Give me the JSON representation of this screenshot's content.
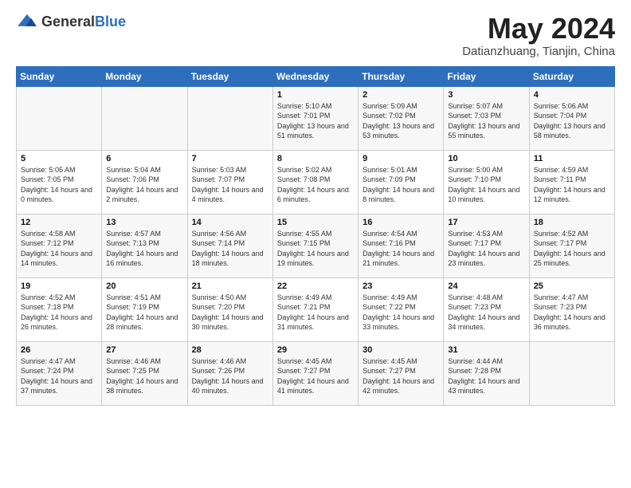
{
  "header": {
    "logo_general": "General",
    "logo_blue": "Blue",
    "month": "May 2024",
    "location": "Datianzhuang, Tianjin, China"
  },
  "weekdays": [
    "Sunday",
    "Monday",
    "Tuesday",
    "Wednesday",
    "Thursday",
    "Friday",
    "Saturday"
  ],
  "weeks": [
    [
      {
        "day": "",
        "sunrise": "",
        "sunset": "",
        "daylight": ""
      },
      {
        "day": "",
        "sunrise": "",
        "sunset": "",
        "daylight": ""
      },
      {
        "day": "",
        "sunrise": "",
        "sunset": "",
        "daylight": ""
      },
      {
        "day": "1",
        "sunrise": "Sunrise: 5:10 AM",
        "sunset": "Sunset: 7:01 PM",
        "daylight": "Daylight: 13 hours and 51 minutes."
      },
      {
        "day": "2",
        "sunrise": "Sunrise: 5:09 AM",
        "sunset": "Sunset: 7:02 PM",
        "daylight": "Daylight: 13 hours and 53 minutes."
      },
      {
        "day": "3",
        "sunrise": "Sunrise: 5:07 AM",
        "sunset": "Sunset: 7:03 PM",
        "daylight": "Daylight: 13 hours and 55 minutes."
      },
      {
        "day": "4",
        "sunrise": "Sunrise: 5:06 AM",
        "sunset": "Sunset: 7:04 PM",
        "daylight": "Daylight: 13 hours and 58 minutes."
      }
    ],
    [
      {
        "day": "5",
        "sunrise": "Sunrise: 5:05 AM",
        "sunset": "Sunset: 7:05 PM",
        "daylight": "Daylight: 14 hours and 0 minutes."
      },
      {
        "day": "6",
        "sunrise": "Sunrise: 5:04 AM",
        "sunset": "Sunset: 7:06 PM",
        "daylight": "Daylight: 14 hours and 2 minutes."
      },
      {
        "day": "7",
        "sunrise": "Sunrise: 5:03 AM",
        "sunset": "Sunset: 7:07 PM",
        "daylight": "Daylight: 14 hours and 4 minutes."
      },
      {
        "day": "8",
        "sunrise": "Sunrise: 5:02 AM",
        "sunset": "Sunset: 7:08 PM",
        "daylight": "Daylight: 14 hours and 6 minutes."
      },
      {
        "day": "9",
        "sunrise": "Sunrise: 5:01 AM",
        "sunset": "Sunset: 7:09 PM",
        "daylight": "Daylight: 14 hours and 8 minutes."
      },
      {
        "day": "10",
        "sunrise": "Sunrise: 5:00 AM",
        "sunset": "Sunset: 7:10 PM",
        "daylight": "Daylight: 14 hours and 10 minutes."
      },
      {
        "day": "11",
        "sunrise": "Sunrise: 4:59 AM",
        "sunset": "Sunset: 7:11 PM",
        "daylight": "Daylight: 14 hours and 12 minutes."
      }
    ],
    [
      {
        "day": "12",
        "sunrise": "Sunrise: 4:58 AM",
        "sunset": "Sunset: 7:12 PM",
        "daylight": "Daylight: 14 hours and 14 minutes."
      },
      {
        "day": "13",
        "sunrise": "Sunrise: 4:57 AM",
        "sunset": "Sunset: 7:13 PM",
        "daylight": "Daylight: 14 hours and 16 minutes."
      },
      {
        "day": "14",
        "sunrise": "Sunrise: 4:56 AM",
        "sunset": "Sunset: 7:14 PM",
        "daylight": "Daylight: 14 hours and 18 minutes."
      },
      {
        "day": "15",
        "sunrise": "Sunrise: 4:55 AM",
        "sunset": "Sunset: 7:15 PM",
        "daylight": "Daylight: 14 hours and 19 minutes."
      },
      {
        "day": "16",
        "sunrise": "Sunrise: 4:54 AM",
        "sunset": "Sunset: 7:16 PM",
        "daylight": "Daylight: 14 hours and 21 minutes."
      },
      {
        "day": "17",
        "sunrise": "Sunrise: 4:53 AM",
        "sunset": "Sunset: 7:17 PM",
        "daylight": "Daylight: 14 hours and 23 minutes."
      },
      {
        "day": "18",
        "sunrise": "Sunrise: 4:52 AM",
        "sunset": "Sunset: 7:17 PM",
        "daylight": "Daylight: 14 hours and 25 minutes."
      }
    ],
    [
      {
        "day": "19",
        "sunrise": "Sunrise: 4:52 AM",
        "sunset": "Sunset: 7:18 PM",
        "daylight": "Daylight: 14 hours and 26 minutes."
      },
      {
        "day": "20",
        "sunrise": "Sunrise: 4:51 AM",
        "sunset": "Sunset: 7:19 PM",
        "daylight": "Daylight: 14 hours and 28 minutes."
      },
      {
        "day": "21",
        "sunrise": "Sunrise: 4:50 AM",
        "sunset": "Sunset: 7:20 PM",
        "daylight": "Daylight: 14 hours and 30 minutes."
      },
      {
        "day": "22",
        "sunrise": "Sunrise: 4:49 AM",
        "sunset": "Sunset: 7:21 PM",
        "daylight": "Daylight: 14 hours and 31 minutes."
      },
      {
        "day": "23",
        "sunrise": "Sunrise: 4:49 AM",
        "sunset": "Sunset: 7:22 PM",
        "daylight": "Daylight: 14 hours and 33 minutes."
      },
      {
        "day": "24",
        "sunrise": "Sunrise: 4:48 AM",
        "sunset": "Sunset: 7:23 PM",
        "daylight": "Daylight: 14 hours and 34 minutes."
      },
      {
        "day": "25",
        "sunrise": "Sunrise: 4:47 AM",
        "sunset": "Sunset: 7:23 PM",
        "daylight": "Daylight: 14 hours and 36 minutes."
      }
    ],
    [
      {
        "day": "26",
        "sunrise": "Sunrise: 4:47 AM",
        "sunset": "Sunset: 7:24 PM",
        "daylight": "Daylight: 14 hours and 37 minutes."
      },
      {
        "day": "27",
        "sunrise": "Sunrise: 4:46 AM",
        "sunset": "Sunset: 7:25 PM",
        "daylight": "Daylight: 14 hours and 38 minutes."
      },
      {
        "day": "28",
        "sunrise": "Sunrise: 4:46 AM",
        "sunset": "Sunset: 7:26 PM",
        "daylight": "Daylight: 14 hours and 40 minutes."
      },
      {
        "day": "29",
        "sunrise": "Sunrise: 4:45 AM",
        "sunset": "Sunset: 7:27 PM",
        "daylight": "Daylight: 14 hours and 41 minutes."
      },
      {
        "day": "30",
        "sunrise": "Sunrise: 4:45 AM",
        "sunset": "Sunset: 7:27 PM",
        "daylight": "Daylight: 14 hours and 42 minutes."
      },
      {
        "day": "31",
        "sunrise": "Sunrise: 4:44 AM",
        "sunset": "Sunset: 7:28 PM",
        "daylight": "Daylight: 14 hours and 43 minutes."
      },
      {
        "day": "",
        "sunrise": "",
        "sunset": "",
        "daylight": ""
      }
    ]
  ]
}
